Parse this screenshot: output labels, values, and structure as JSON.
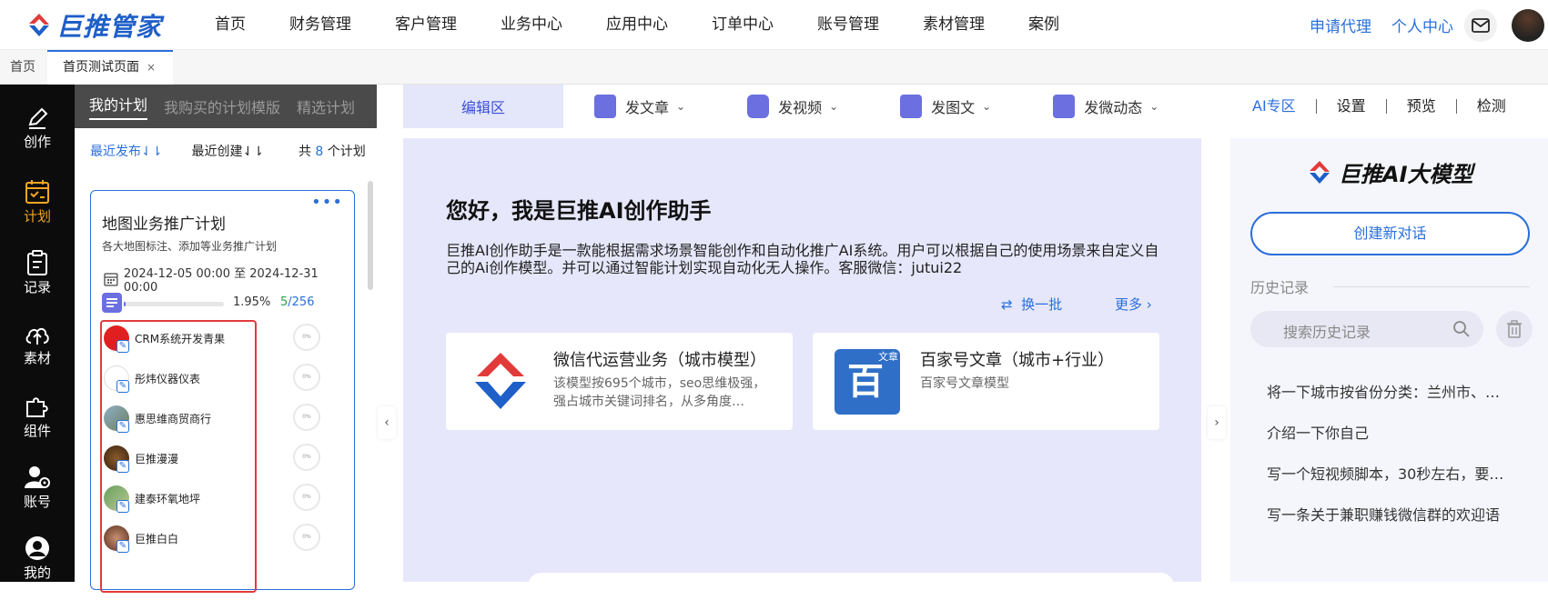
{
  "brand": {
    "name": "巨推管家"
  },
  "nav": [
    "首页",
    "财务管理",
    "客户管理",
    "业务中心",
    "应用中心",
    "订单中心",
    "账号管理",
    "素材管理",
    "案例"
  ],
  "top_links": {
    "agent": "申请代理",
    "personal": "个人中心"
  },
  "tabs": {
    "home": "首页",
    "active": "首页测试页面",
    "close": "×"
  },
  "rail": [
    {
      "label": "创作",
      "icon": "pen-icon"
    },
    {
      "label": "计划",
      "icon": "calendar-check-icon"
    },
    {
      "label": "记录",
      "icon": "clipboard-icon"
    },
    {
      "label": "素材",
      "icon": "cloud-upload-icon"
    },
    {
      "label": "组件",
      "icon": "puzzle-icon"
    },
    {
      "label": "账号",
      "icon": "user-gear-icon"
    },
    {
      "label": "我的",
      "icon": "user-circle-icon"
    }
  ],
  "plan_panel": {
    "tabs": [
      "我的计划",
      "我购买的计划模版",
      "精选计划"
    ],
    "sort_recent_publish": "最近发布⇃⇂",
    "sort_recent_create": "最近创建⇃⇂",
    "count_prefix": "共",
    "count": "8",
    "count_suffix": "个计划",
    "card": {
      "more": "•••",
      "title": "地图业务推广计划",
      "desc": "各大地图标注、添加等业务推广计划",
      "date_range": "2024-12-05 00:00 至 2024-12-31 00:00",
      "progress_pct": "1.95%",
      "progress_value": 0.0195,
      "done": "5",
      "total": "/256",
      "accounts": [
        {
          "name": "CRM系统开发青果",
          "progress": "0%"
        },
        {
          "name": "彤炜仪器仪表",
          "progress": "0%"
        },
        {
          "name": "惠思维商贸商行",
          "progress": "0%"
        },
        {
          "name": "巨推漫漫",
          "progress": "0%"
        },
        {
          "name": "建泰环氧地坪",
          "progress": "0%"
        },
        {
          "name": "巨推白白",
          "progress": "0%"
        }
      ]
    }
  },
  "edit_tabs": {
    "active": "编辑区",
    "article": "发文章",
    "video": "发视频",
    "image_text": "发图文",
    "micro": "发微动态"
  },
  "center": {
    "hello": "您好，我是巨推AI创作助手",
    "intro": "巨推AI创作助手是一款能根据需求场景智能创作和自动化推广AI系统。用户可以根据自己的使用场景来自定义自己的Ai创作模型。并可以通过智能计划实现自动化无人操作。客服微信：jutui22",
    "refresh": "换一批",
    "more": "更多",
    "models": [
      {
        "title": "微信代运营业务（城市模型）",
        "desc": "该模型按695个城市，seo思维极强，强占城市关键词排名，从多角度…"
      },
      {
        "title": "百家号文章（城市+行业）",
        "desc": "百家号文章模型",
        "badge": "文章",
        "glyph": "百"
      }
    ]
  },
  "right": {
    "tabs": [
      "AI专区",
      "设置",
      "预览",
      "检测"
    ],
    "logo_text": "巨推AI大模型",
    "new_chat": "创建新对话",
    "history_label": "历史记录",
    "search_placeholder": "搜索历史记录",
    "history": [
      "将一下城市按省份分类：兰州市、…",
      "介绍一下你自己",
      "写一个短视频脚本，30秒左右，要…",
      "写一条关于兼职赚钱微信群的欢迎语"
    ]
  },
  "colors": {
    "accent": "#2a6fdb",
    "rail_active": "#f5a623",
    "canvas": "#e6e7fa"
  }
}
